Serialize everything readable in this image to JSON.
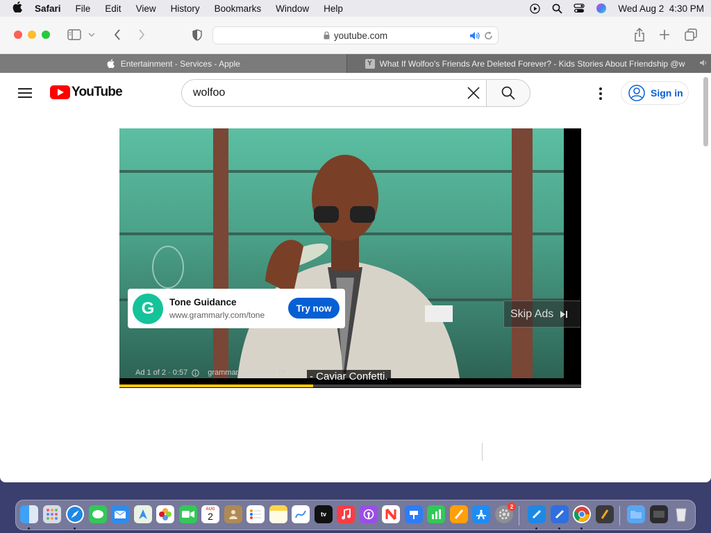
{
  "menubar": {
    "app": "Safari",
    "items": [
      "File",
      "Edit",
      "View",
      "History",
      "Bookmarks",
      "Window",
      "Help"
    ],
    "datetime": "Wed Aug 2  4:30 PM"
  },
  "browser": {
    "address": "youtube.com",
    "tabs": [
      {
        "title": "Entertainment - Services - Apple",
        "icon": "apple-icon",
        "active": true
      },
      {
        "title": "What If Wolfoo's Friends Are Deleted Forever? - Kids Stories About Friendship @wolf...",
        "icon": "youtube-favicon",
        "active": false
      }
    ]
  },
  "youtube": {
    "logo_text": "YouTube",
    "search_value": "wolfoo",
    "sign_in": "Sign in",
    "ad": {
      "title": "Tone Guidance",
      "url": "www.grammarly.com/tone",
      "cta": "Try now",
      "skip": "Skip Ads",
      "info": "Ad 1 of 2 · 0:57",
      "link": "grammarly.com/tone",
      "caption": "- Caviar Confetti.",
      "progress": 0.42
    }
  },
  "colors": {
    "youtube_red": "#ff0000",
    "brand_blue": "#065fd4",
    "grammarly_green": "#15c39a",
    "progress_yellow": "#ffcc00"
  },
  "dock": {
    "calendar_month": "AUG",
    "calendar_day": "2",
    "settings_badge": "2"
  }
}
